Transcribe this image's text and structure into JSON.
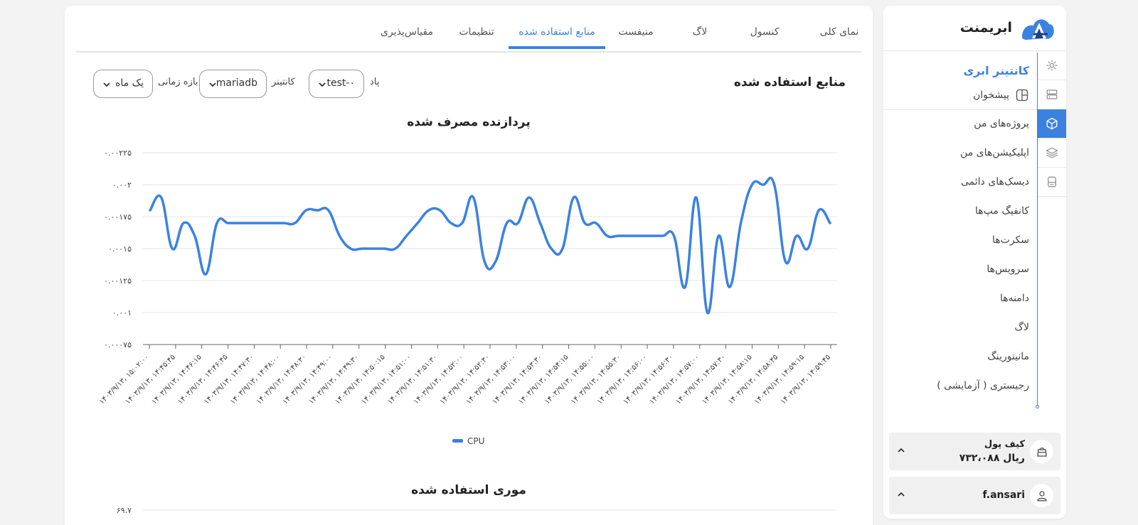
{
  "brand": {
    "name": "ابریمنت"
  },
  "sidebar": {
    "section_title": "کانتینر ابری",
    "dashboard_label": "پیشخوان",
    "items": [
      {
        "label": "پروژه‌های من"
      },
      {
        "label": "اپلیکیشن‌های من"
      },
      {
        "label": "دیسک‌های دائمی"
      },
      {
        "label": "کانفیگ مپ‌ها"
      },
      {
        "label": "سکرت‌ها"
      },
      {
        "label": "سرویس‌ها"
      },
      {
        "label": "دامنه‌ها"
      },
      {
        "label": "لاگ"
      },
      {
        "label": "مانیتورینگ"
      },
      {
        "label": "رجیستری ( آزمایشی )"
      }
    ],
    "rail_icons": [
      "gear-icon",
      "server-icon",
      "cube-icon",
      "layers-icon",
      "database-icon"
    ],
    "wallet": {
      "title": "کیف پول",
      "amount": "۷۳۲،۰۸۸ ریال"
    },
    "user": {
      "username": "f.ansari"
    }
  },
  "tabs": [
    {
      "label": "نمای کلی"
    },
    {
      "label": "کنسول"
    },
    {
      "label": "لاگ"
    },
    {
      "label": "منیفست"
    },
    {
      "label": "منابع استفاده شده",
      "active": true
    },
    {
      "label": "تنظیمات"
    },
    {
      "label": "مقیاس‌پذیری"
    }
  ],
  "main": {
    "title": "منابع استفاده شده",
    "filters": {
      "pod_label": "پاد",
      "pod_value": "test-۰",
      "container_label": "کانتینر",
      "container_value": "mariadb",
      "range_label": "بازه زمانی",
      "range_value": "یک ماه"
    }
  },
  "accent_color": "#3b82e0",
  "chart_data": [
    {
      "type": "line",
      "title": "پردازنده مصرف شده",
      "yticks": [
        "۰.۰۰۲۲۵",
        "۰.۰۰۲",
        "۰.۰۰۱۷۵",
        "۰.۰۰۱۵",
        "۰.۰۰۱۲۵",
        "۰.۰۰۱",
        "۰.۰۰۰۷۵"
      ],
      "ylim": [
        0.00075,
        0.00225
      ],
      "categories": [
        "۱۴۰۳/۹/۱۳، ۱۵:۰۲:۰۰",
        "۱۴۰۳/۹/۱۳، ۱۴:۴۵:۴۵",
        "۱۴۰۳/۹/۱۳، ۱۴:۴۶:۱۵",
        "۱۴۰۳/۹/۱۳، ۱۴:۴۶:۴۵",
        "۱۴۰۳/۹/۱۳، ۱۴:۴۷:۳۰",
        "۱۴۰۳/۹/۱۳، ۱۴:۴۸:۰۰",
        "۱۴۰۳/۹/۱۳، ۱۴:۴۸:۳۰",
        "۱۴۰۳/۹/۱۳، ۱۴:۴۹:۰۰",
        "۱۴۰۳/۹/۱۳، ۱۴:۴۹:۳۰",
        "۱۴۰۳/۹/۱۳، ۱۴:۵۰:۱۵",
        "۱۴۰۳/۹/۱۳، ۱۴:۵۱:۰۰",
        "۱۴۰۳/۹/۱۳، ۱۴:۵۱:۳۰",
        "۱۴۰۳/۹/۱۳، ۱۴:۵۲:۰۰",
        "۱۴۰۳/۹/۱۳، ۱۴:۵۲:۳۰",
        "۱۴۰۳/۹/۱۳، ۱۴:۵۳:۰۰",
        "۱۴۰۳/۹/۱۳، ۱۴:۵۳:۳۰",
        "۱۴۰۳/۹/۱۳، ۱۴:۵۴:۱۵",
        "۱۴۰۳/۹/۱۳، ۱۴:۵۵:۰۰",
        "۱۴۰۳/۹/۱۳، ۱۴:۵۵:۳۰",
        "۱۴۰۳/۹/۱۳، ۱۴:۵۶:۰۰",
        "۱۴۰۳/۹/۱۳، ۱۴:۵۶:۳۰",
        "۱۴۰۳/۹/۱۳، ۱۴:۵۷:۰۰",
        "۱۴۰۳/۹/۱۳، ۱۴:۵۷:۳۰",
        "۱۴۰۳/۹/۱۳، ۱۴:۵۸:۱۵",
        "۱۴۰۳/۹/۱۳، ۱۴:۵۸:۴۵",
        "۱۴۰۳/۹/۱۳، ۱۴:۵۹:۱۵",
        "۱۴۰۳/۹/۱۳، ۱۴:۵۹:۴۵"
      ],
      "series": [
        {
          "name": "CPU",
          "color": "#3b82e0",
          "values": [
            0.0018,
            0.0019,
            0.0015,
            0.0017,
            0.0016,
            0.0013,
            0.0017,
            0.0017,
            0.0017,
            0.0017,
            0.0017,
            0.0017,
            0.0017,
            0.0017,
            0.0018,
            0.0018,
            0.0018,
            0.0016,
            0.0015,
            0.0015,
            0.0015,
            0.0015,
            0.0015,
            0.0016,
            0.0017,
            0.0018,
            0.0018,
            0.0017,
            0.0017,
            0.0019,
            0.0014,
            0.0014,
            0.0017,
            0.0017,
            0.0019,
            0.0017,
            0.0015,
            0.0015,
            0.0019,
            0.0017,
            0.0017,
            0.0016,
            0.0016,
            0.0016,
            0.0016,
            0.0016,
            0.0016,
            0.0016,
            0.0012,
            0.0019,
            0.001,
            0.0016,
            0.0012,
            0.0017,
            0.002,
            0.002,
            0.002,
            0.0014,
            0.0016,
            0.0015,
            0.0018,
            0.0017
          ]
        }
      ],
      "legend": "bottom"
    },
    {
      "type": "line",
      "title": "موری استفاده شده",
      "yticks": [
        "۶۹.۷"
      ]
    }
  ]
}
